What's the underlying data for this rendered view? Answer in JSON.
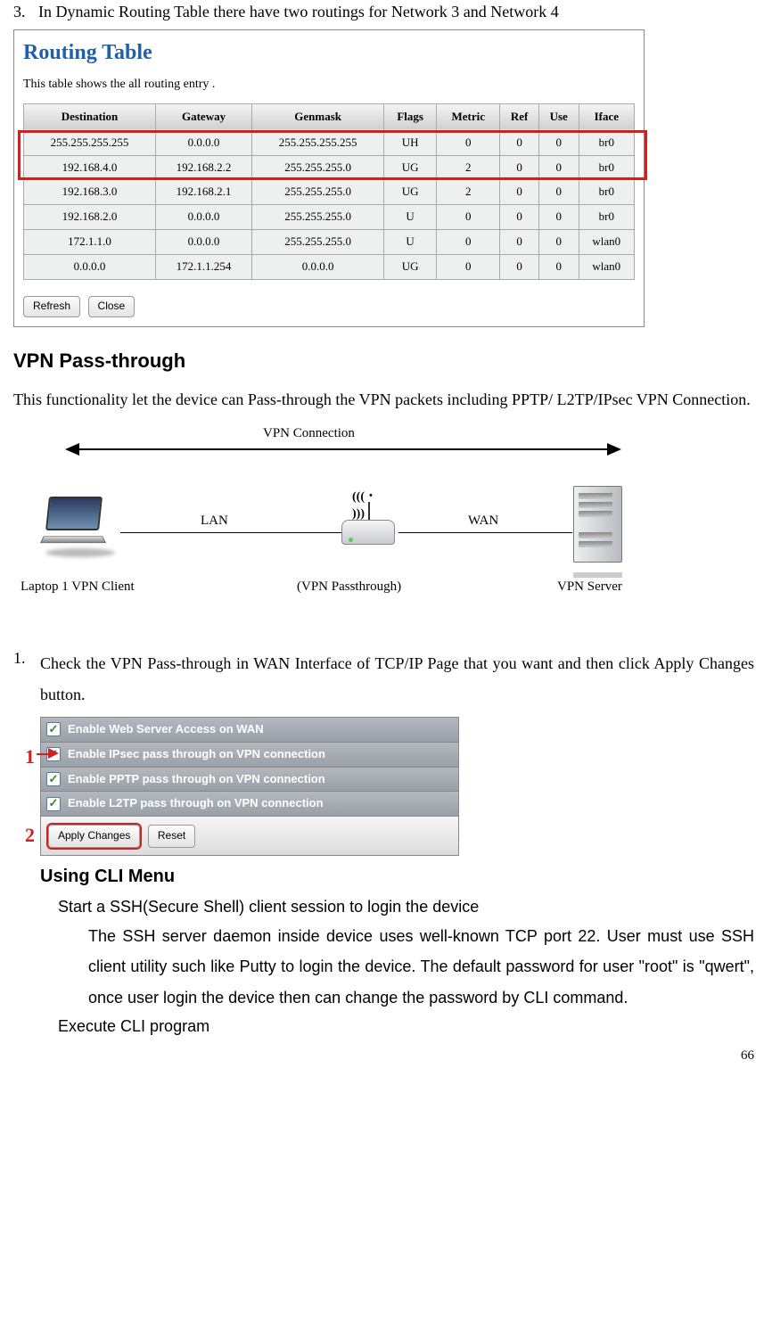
{
  "step3": {
    "num": "3.",
    "text": "In Dynamic Routing Table there have two routings for Network 3 and Network 4"
  },
  "routing": {
    "title": "Routing Table",
    "subtitle": "This table shows the all routing entry .",
    "headers": [
      "Destination",
      "Gateway",
      "Genmask",
      "Flags",
      "Metric",
      "Ref",
      "Use",
      "Iface"
    ],
    "rows": [
      [
        "255.255.255.255",
        "0.0.0.0",
        "255.255.255.255",
        "UH",
        "0",
        "0",
        "0",
        "br0"
      ],
      [
        "192.168.4.0",
        "192.168.2.2",
        "255.255.255.0",
        "UG",
        "2",
        "0",
        "0",
        "br0"
      ],
      [
        "192.168.3.0",
        "192.168.2.1",
        "255.255.255.0",
        "UG",
        "2",
        "0",
        "0",
        "br0"
      ],
      [
        "192.168.2.0",
        "0.0.0.0",
        "255.255.255.0",
        "U",
        "0",
        "0",
        "0",
        "br0"
      ],
      [
        "172.1.1.0",
        "0.0.0.0",
        "255.255.255.0",
        "U",
        "0",
        "0",
        "0",
        "wlan0"
      ],
      [
        "0.0.0.0",
        "172.1.1.254",
        "0.0.0.0",
        "UG",
        "0",
        "0",
        "0",
        "wlan0"
      ]
    ],
    "buttons": {
      "refresh": "Refresh",
      "close": "Close"
    }
  },
  "vpn": {
    "heading": "VPN Pass-through",
    "body": "This functionality let the device can Pass-through the VPN packets including PPTP/ L2TP/IPsec VPN Connection.",
    "diagram": {
      "connection": "VPN Connection",
      "lan": "LAN",
      "wan": "WAN",
      "laptop": "Laptop 1 VPN Client",
      "router": "(VPN Passthrough)",
      "server": "VPN Server"
    }
  },
  "step1": {
    "num": "1.",
    "text": "Check the VPN Pass-through in WAN Interface of TCP/IP Page that you want and then click Apply Changes button."
  },
  "checks": {
    "c1": "Enable Web Server Access on WAN",
    "c2": "Enable IPsec pass through on VPN connection",
    "c3": "Enable PPTP pass through on VPN connection",
    "c4": "Enable L2TP pass through on VPN connection",
    "apply": "Apply Changes",
    "reset": "Reset",
    "m1": "1",
    "m2": "2"
  },
  "cli": {
    "heading": "Using CLI Menu",
    "sub1": "Start a SSH(Secure Shell) client session to login the device",
    "para1": "The SSH server daemon inside device uses well-known TCP port 22. User must use SSH client utility such like Putty to login the device. The default password for user \"root\" is \"qwert\", once user login the device then can change the password by CLI command.",
    "sub2": "Execute CLI program"
  },
  "page": "66"
}
